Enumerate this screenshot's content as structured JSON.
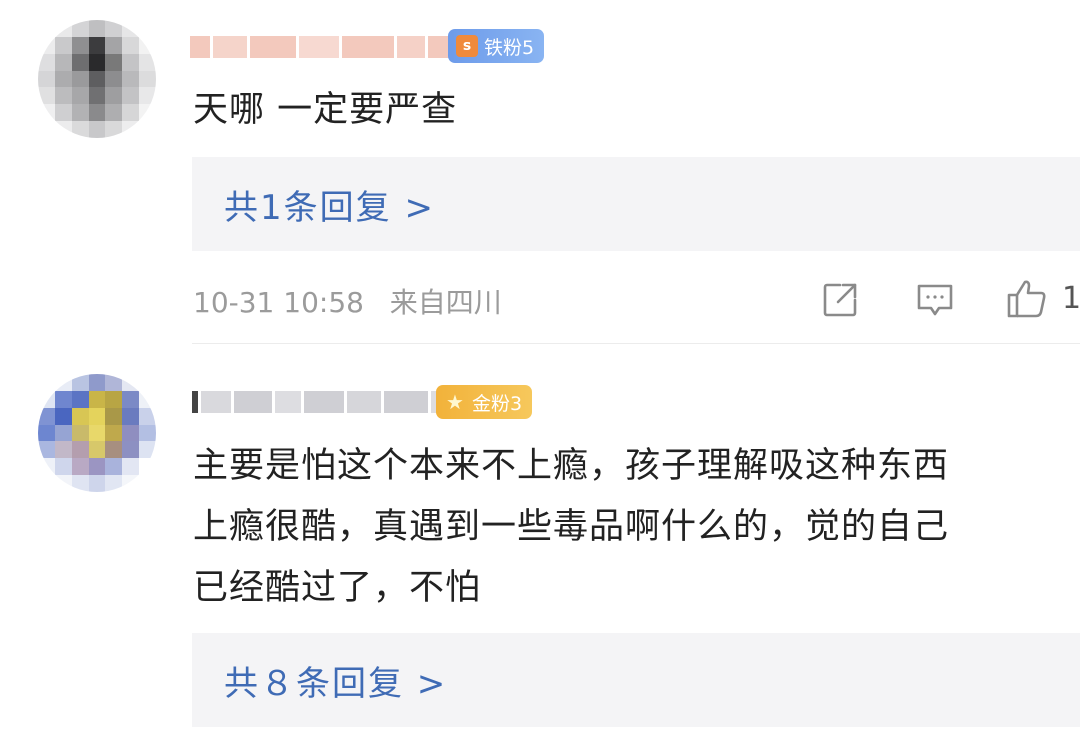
{
  "comments": [
    {
      "badge_label": "铁粉5",
      "badge_icon": "s",
      "content": "天哪 一定要严查",
      "reply_link": "共1条回复 >",
      "timestamp": "10-31 10:58",
      "location": "来自四川",
      "like_count": "1"
    },
    {
      "badge_label": "金粉3",
      "badge_icon": "★",
      "content_lines": [
        "主要是怕这个本来不上瘾，孩子理解吸这种东西",
        "上瘾很酷，真遇到一些毒品啊什么的，觉的自己",
        "已经酷过了，不怕"
      ],
      "reply_link": "共８条回复 >"
    }
  ],
  "colors": {
    "link": "#3f6bb5",
    "iron_badge": "#6d9bea",
    "gold_badge": "#f2b23a",
    "meta_text": "#9b9b9b",
    "reply_bg": "#f4f4f6"
  },
  "icons": [
    "share-icon",
    "comment-icon",
    "like-icon"
  ]
}
